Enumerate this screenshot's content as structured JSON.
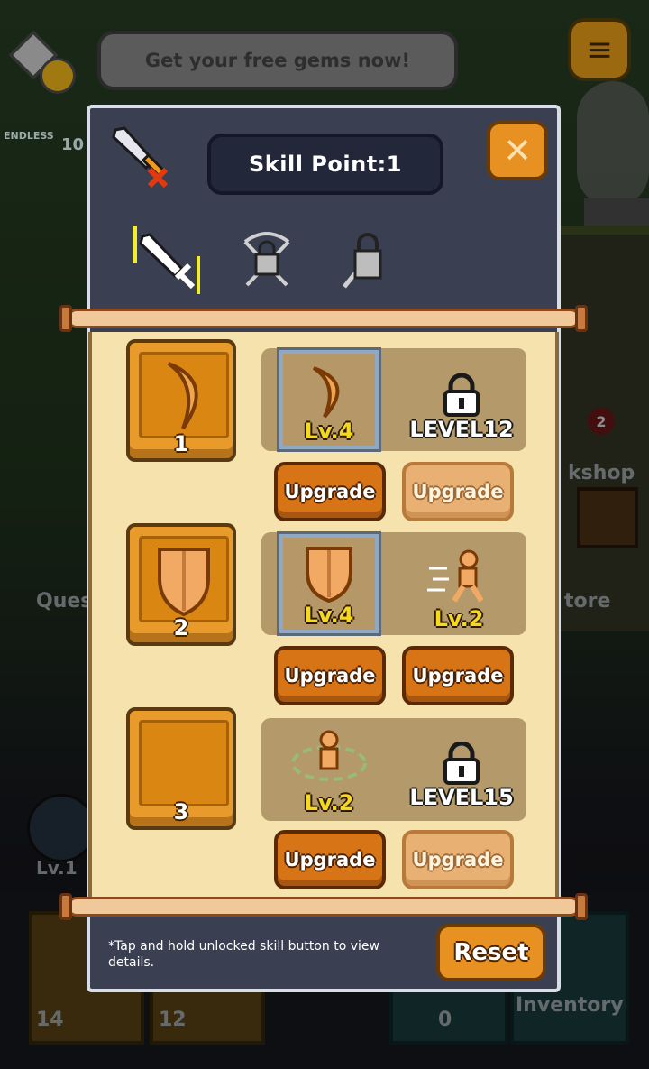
{
  "banner": {
    "text": "Get your free gems now!"
  },
  "hud": {
    "mode_label": "ENDLESS",
    "mode_value": "10"
  },
  "background": {
    "workshop_label": "kshop",
    "workshop_badge": "2",
    "quest_label": "Ques",
    "store_label": "tore",
    "player_level": "Lv.1",
    "slot1_count": "14",
    "slot2_count": "12",
    "slot3_count": "0",
    "inventory_label": "Inventory"
  },
  "dialog": {
    "skill_point_label": "Skill Point:1",
    "close_symbol": "✕",
    "tabs": [
      {
        "name": "sword",
        "selected": true
      },
      {
        "name": "bow",
        "locked": true
      },
      {
        "name": "magic",
        "locked": true
      }
    ],
    "rows": [
      {
        "slot_number": "1",
        "skills": [
          {
            "icon": "boomerang-slash-icon",
            "level": "Lv.4",
            "selected": true
          },
          {
            "icon": "lock-icon",
            "locked_label": "LEVEL12"
          }
        ],
        "buttons": [
          {
            "label": "Upgrade",
            "enabled": true
          },
          {
            "label": "Upgrade",
            "enabled": false
          }
        ]
      },
      {
        "slot_number": "2",
        "skills": [
          {
            "icon": "shield-icon",
            "level": "Lv.4",
            "selected": true
          },
          {
            "icon": "dash-runner-icon",
            "level": "Lv.2"
          }
        ],
        "buttons": [
          {
            "label": "Upgrade",
            "enabled": true
          },
          {
            "label": "Upgrade",
            "enabled": true
          }
        ]
      },
      {
        "slot_number": "3",
        "skills": [
          {
            "icon": "whirlwind-icon",
            "level": "Lv.2"
          },
          {
            "icon": "lock-icon",
            "locked_label": "LEVEL15"
          }
        ],
        "buttons": [
          {
            "label": "Upgrade",
            "enabled": true
          },
          {
            "label": "Upgrade",
            "enabled": false
          }
        ]
      }
    ],
    "footer_note": "*Tap and hold unlocked skill button to view details.",
    "reset_label": "Reset"
  },
  "colors": {
    "accent_orange": "#e79123",
    "level_yellow": "#f8d81c",
    "dialog_bg": "#3a3f52",
    "paper": "#f6e2ad"
  }
}
